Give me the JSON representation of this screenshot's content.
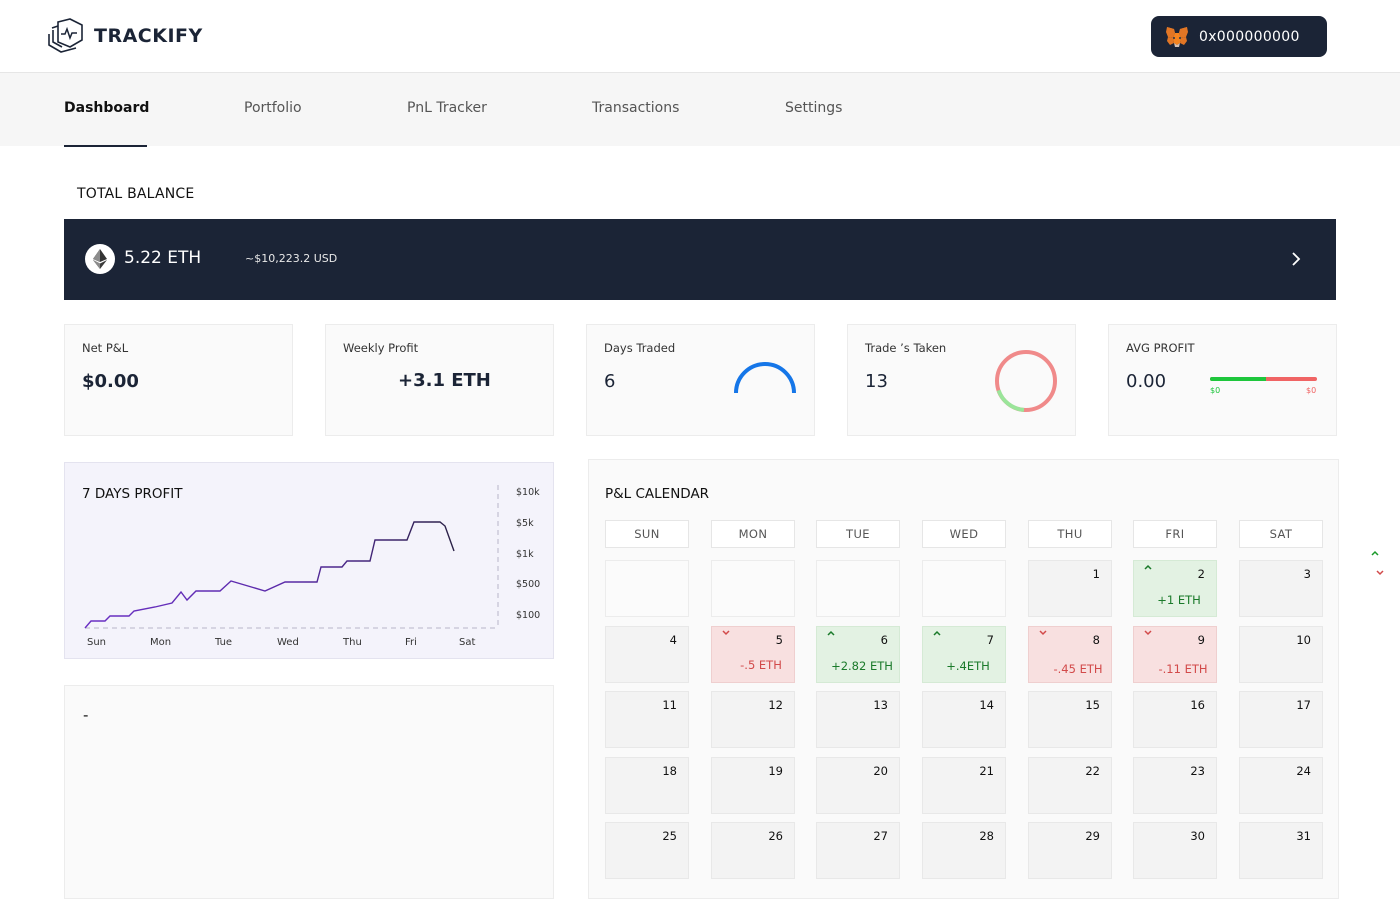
{
  "header": {
    "brand": "TRACKIFY",
    "wallet_address": "0x000000000"
  },
  "nav": {
    "tabs": [
      {
        "label": "Dashboard",
        "active": true
      },
      {
        "label": "Portfolio",
        "active": false
      },
      {
        "label": "PnL Tracker",
        "active": false
      },
      {
        "label": "Transactions",
        "active": false
      },
      {
        "label": "Settings",
        "active": false
      }
    ]
  },
  "balance": {
    "title": "TOTAL BALANCE",
    "eth": "5.22 ETH",
    "usd": "~$10,223.2 USD"
  },
  "stats": {
    "net_pnl": {
      "label": "Net P&L",
      "value": "$0.00"
    },
    "weekly_profit": {
      "label": "Weekly Profit",
      "value": "+3.1 ETH"
    },
    "days_traded": {
      "label": "Days Traded",
      "value": "6"
    },
    "trades_taken": {
      "label": "Trade ’s Taken",
      "value": "13"
    },
    "avg_profit": {
      "label": "AVG PROFIT",
      "value": "0.00",
      "low_label": "$0",
      "high_label": "$0",
      "gain_fraction": 0.52
    }
  },
  "profit_chart": {
    "title": "7 DAYS PROFIT",
    "x_labels": [
      "Sun",
      "Mon",
      "Tue",
      "Wed",
      "Thu",
      "Fri",
      "Sat"
    ],
    "y_labels": [
      "$10k",
      "$5k",
      "$1k",
      "$500",
      "$100"
    ]
  },
  "empty_panel": {
    "text": "-"
  },
  "calendar": {
    "title": "P&L CALENDAR",
    "weekdays": [
      "SUN",
      "MON",
      "TUE",
      "WED",
      "THU",
      "FRI",
      "SAT"
    ],
    "cells": [
      {
        "day": "",
        "status": "blank",
        "amount": ""
      },
      {
        "day": "",
        "status": "blank",
        "amount": ""
      },
      {
        "day": "",
        "status": "blank",
        "amount": ""
      },
      {
        "day": "",
        "status": "blank",
        "amount": ""
      },
      {
        "day": "1",
        "status": "none",
        "amount": ""
      },
      {
        "day": "2",
        "status": "gain",
        "amount": "+1 ETH"
      },
      {
        "day": "3",
        "status": "none",
        "amount": ""
      },
      {
        "day": "4",
        "status": "none",
        "amount": ""
      },
      {
        "day": "5",
        "status": "loss",
        "amount": "-.5 ETH"
      },
      {
        "day": "6",
        "status": "gain",
        "amount": "+2.82 ETH"
      },
      {
        "day": "7",
        "status": "gain",
        "amount": "+.4ETH"
      },
      {
        "day": "8",
        "status": "loss",
        "amount": "-.45 ETH"
      },
      {
        "day": "9",
        "status": "loss",
        "amount": "-.11 ETH"
      },
      {
        "day": "10",
        "status": "none",
        "amount": ""
      },
      {
        "day": "11",
        "status": "none",
        "amount": ""
      },
      {
        "day": "12",
        "status": "none",
        "amount": ""
      },
      {
        "day": "13",
        "status": "none",
        "amount": ""
      },
      {
        "day": "14",
        "status": "none",
        "amount": ""
      },
      {
        "day": "15",
        "status": "none",
        "amount": ""
      },
      {
        "day": "16",
        "status": "none",
        "amount": ""
      },
      {
        "day": "17",
        "status": "none",
        "amount": ""
      },
      {
        "day": "18",
        "status": "none",
        "amount": ""
      },
      {
        "day": "19",
        "status": "none",
        "amount": ""
      },
      {
        "day": "20",
        "status": "none",
        "amount": ""
      },
      {
        "day": "21",
        "status": "none",
        "amount": ""
      },
      {
        "day": "22",
        "status": "none",
        "amount": ""
      },
      {
        "day": "23",
        "status": "none",
        "amount": ""
      },
      {
        "day": "24",
        "status": "none",
        "amount": ""
      },
      {
        "day": "25",
        "status": "none",
        "amount": ""
      },
      {
        "day": "26",
        "status": "none",
        "amount": ""
      },
      {
        "day": "27",
        "status": "none",
        "amount": ""
      },
      {
        "day": "28",
        "status": "none",
        "amount": ""
      },
      {
        "day": "29",
        "status": "none",
        "amount": ""
      },
      {
        "day": "30",
        "status": "none",
        "amount": ""
      },
      {
        "day": "31",
        "status": "none",
        "amount": ""
      }
    ]
  },
  "colors": {
    "navy": "#1b2436",
    "gain": "#1a7a2a",
    "loss": "#d24a4a",
    "accent_blue": "#1576e8",
    "chart_line": "#5a2aa8"
  }
}
